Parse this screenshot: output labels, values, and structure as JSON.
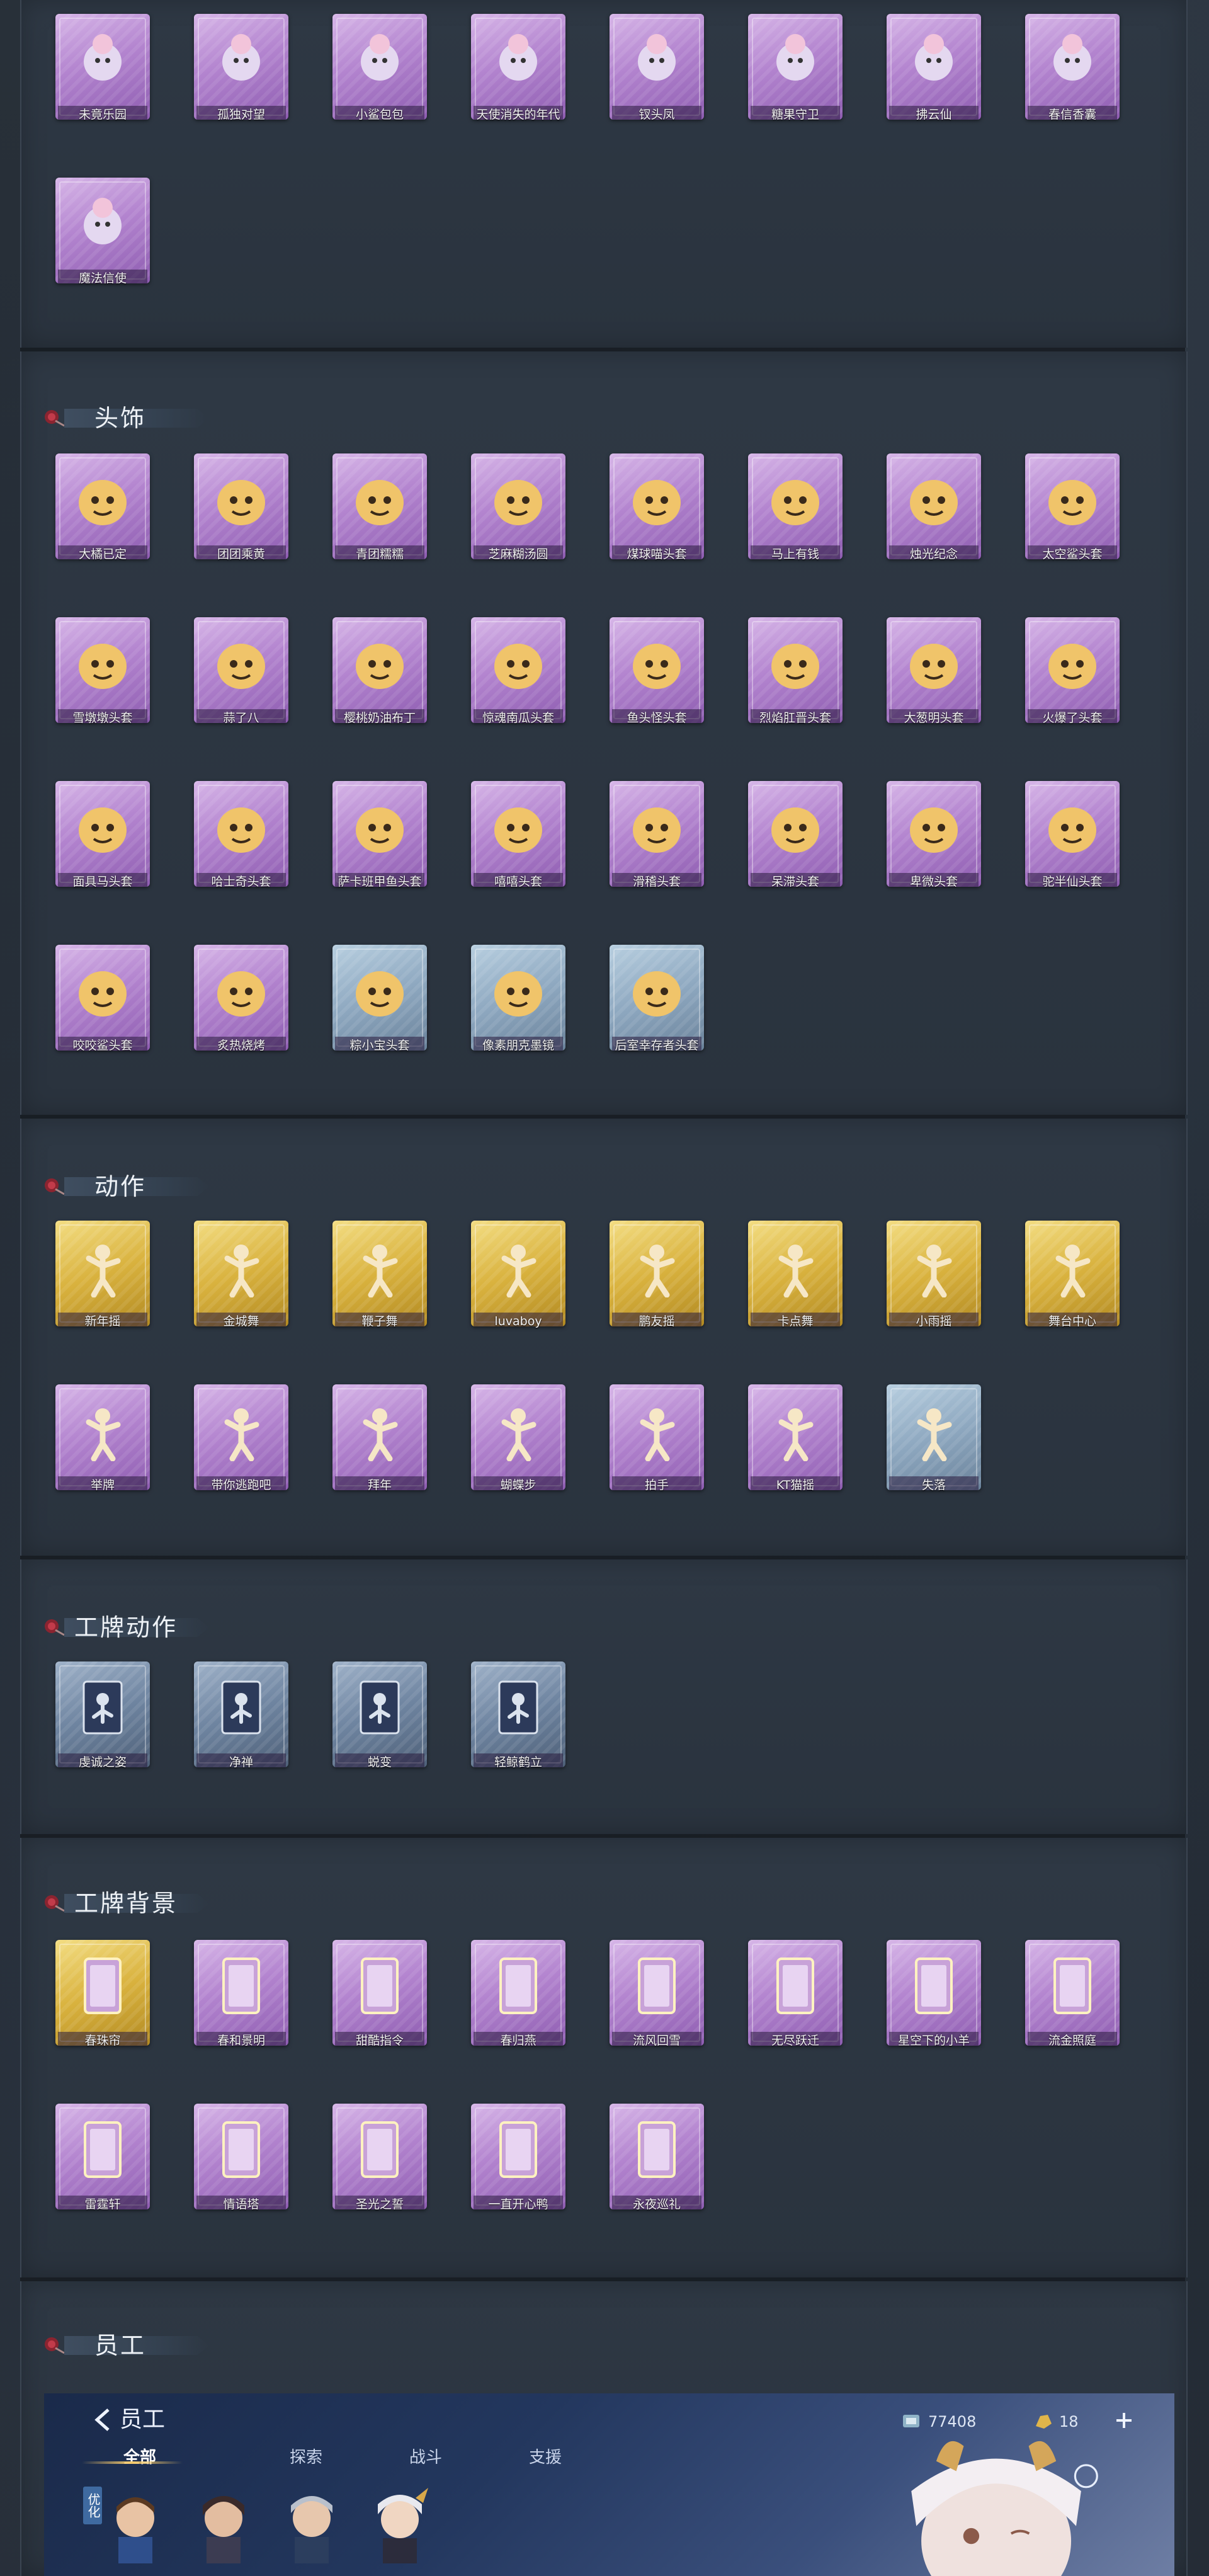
{
  "sections": {
    "top_items": [
      {
        "label": "未竟乐园",
        "icon": "pink-hair-doll",
        "rarity": "purple"
      },
      {
        "label": "孤独对望",
        "icon": "silver-lantern",
        "rarity": "purple"
      },
      {
        "label": "小鲨包包",
        "icon": "shark-plush",
        "rarity": "purple"
      },
      {
        "label": "天使消失的年代",
        "icon": "angel-portrait",
        "rarity": "purple"
      },
      {
        "label": "钗头凤",
        "icon": "phoenix-hairpin",
        "rarity": "purple"
      },
      {
        "label": "糖果守卫",
        "icon": "candy-guard",
        "rarity": "purple"
      },
      {
        "label": "拂云仙",
        "icon": "cloud-fairy",
        "rarity": "purple"
      },
      {
        "label": "春信香囊",
        "icon": "green-sachet",
        "rarity": "purple"
      },
      {
        "label": "魔法信使",
        "icon": "elephant-plush",
        "rarity": "purple"
      }
    ],
    "headwear": {
      "title": "头饰",
      "items": [
        {
          "label": "大橘已定",
          "icon": "orange-face",
          "rarity": "purple"
        },
        {
          "label": "团团乘黄",
          "icon": "hamster-face",
          "rarity": "purple"
        },
        {
          "label": "青团糯糯",
          "icon": "green-bun",
          "rarity": "purple"
        },
        {
          "label": "芝麻糊汤圆",
          "icon": "rice-ball",
          "rarity": "purple"
        },
        {
          "label": "煤球喵头套",
          "icon": "black-cat-head",
          "rarity": "purple"
        },
        {
          "label": "马上有钱",
          "icon": "red-horse-head",
          "rarity": "purple"
        },
        {
          "label": "烛光纪念",
          "icon": "candle-head",
          "rarity": "purple"
        },
        {
          "label": "太空鲨头套",
          "icon": "space-shark-head",
          "rarity": "purple"
        },
        {
          "label": "雪墩墩头套",
          "icon": "snow-bear-head",
          "rarity": "purple"
        },
        {
          "label": "蒜了八",
          "icon": "garlic-head",
          "rarity": "purple"
        },
        {
          "label": "樱桃奶油布丁",
          "icon": "pudding-head",
          "rarity": "purple"
        },
        {
          "label": "惊魂南瓜头套",
          "icon": "pumpkin-head",
          "rarity": "purple"
        },
        {
          "label": "鱼头怪头套",
          "icon": "fish-head",
          "rarity": "purple"
        },
        {
          "label": "烈焰肛晋头套",
          "icon": "yellow-rabbit-head",
          "rarity": "purple"
        },
        {
          "label": "大葱明头套",
          "icon": "scallion-head",
          "rarity": "purple"
        },
        {
          "label": "火爆了头套",
          "icon": "fire-head",
          "rarity": "purple"
        },
        {
          "label": "面具马头套",
          "icon": "horse-mask",
          "rarity": "purple"
        },
        {
          "label": "哈士奇头套",
          "icon": "husky-head",
          "rarity": "purple"
        },
        {
          "label": "萨卡班甲鱼头套",
          "icon": "fish-helmet",
          "rarity": "purple"
        },
        {
          "label": "嘻嘻头套",
          "icon": "grin-emoji",
          "rarity": "purple"
        },
        {
          "label": "滑稽头套",
          "icon": "funny-emoji",
          "rarity": "purple"
        },
        {
          "label": "呆滞头套",
          "icon": "dazed-emoji",
          "rarity": "purple"
        },
        {
          "label": "卑微头套",
          "icon": "humble-emoji",
          "rarity": "purple"
        },
        {
          "label": "驼半仙头套",
          "icon": "raccoon-head",
          "rarity": "purple"
        },
        {
          "label": "咬咬鲨头套",
          "icon": "bite-shark-head",
          "rarity": "purple"
        },
        {
          "label": "炙热烧烤",
          "icon": "bbq-head",
          "rarity": "purple"
        },
        {
          "label": "粽小宝头套",
          "icon": "zongzi-head",
          "rarity": "blue"
        },
        {
          "label": "像素朋克墨镜",
          "icon": "pixel-sunglasses",
          "rarity": "blue"
        },
        {
          "label": "后室幸存者头套",
          "icon": "survivor-helmet",
          "rarity": "blue"
        }
      ]
    },
    "actions": {
      "title": "动作",
      "items": [
        {
          "label": "新年摇",
          "icon": "dance-pose",
          "rarity": "gold"
        },
        {
          "label": "金城舞",
          "icon": "dance-pose",
          "rarity": "gold"
        },
        {
          "label": "鞭子舞",
          "icon": "dance-pose",
          "rarity": "gold"
        },
        {
          "label": "luvaboy",
          "icon": "dance-pose",
          "rarity": "gold"
        },
        {
          "label": "鹏友摇",
          "icon": "dance-pose",
          "rarity": "gold"
        },
        {
          "label": "卡点舞",
          "icon": "dance-pose",
          "rarity": "gold"
        },
        {
          "label": "小雨摇",
          "icon": "dance-pose",
          "rarity": "gold"
        },
        {
          "label": "舞台中心",
          "icon": "dance-pose",
          "rarity": "gold"
        },
        {
          "label": "举牌",
          "icon": "sign-pose",
          "rarity": "purple"
        },
        {
          "label": "带你逃跑吧",
          "icon": "run-pose",
          "rarity": "purple"
        },
        {
          "label": "拜年",
          "icon": "bow-pose",
          "rarity": "purple"
        },
        {
          "label": "蝴蝶步",
          "icon": "butterfly-pose",
          "rarity": "purple"
        },
        {
          "label": "拍手",
          "icon": "clap-pose",
          "rarity": "purple"
        },
        {
          "label": "KT猫摇",
          "icon": "cat-pose",
          "rarity": "purple"
        },
        {
          "label": "失落",
          "icon": "crawl-pose",
          "rarity": "blue"
        }
      ]
    },
    "badge_actions": {
      "title": "工牌动作",
      "items": [
        {
          "label": "虔诚之姿",
          "icon": "card-pose",
          "rarity": "navy"
        },
        {
          "label": "净禅",
          "icon": "card-pose",
          "rarity": "navy"
        },
        {
          "label": "蜕变",
          "icon": "card-pose",
          "rarity": "navy"
        },
        {
          "label": "轻鲸鹤立",
          "icon": "card-pose",
          "rarity": "navy"
        }
      ]
    },
    "badge_backgrounds": {
      "title": "工牌背景",
      "items": [
        {
          "label": "春珠帘",
          "icon": "red-card",
          "rarity": "gold"
        },
        {
          "label": "春和景明",
          "icon": "yellow-card",
          "rarity": "purple"
        },
        {
          "label": "甜酷指令",
          "icon": "pink-card",
          "rarity": "purple"
        },
        {
          "label": "春归燕",
          "icon": "rose-card",
          "rarity": "purple"
        },
        {
          "label": "流风回雪",
          "icon": "pastel-card",
          "rarity": "purple"
        },
        {
          "label": "无尽跃迁",
          "icon": "galaxy-card",
          "rarity": "purple"
        },
        {
          "label": "星空下的小羊",
          "icon": "sky-card",
          "rarity": "purple"
        },
        {
          "label": "流金照庭",
          "icon": "gold-frame-card",
          "rarity": "purple"
        },
        {
          "label": "雷霆轩",
          "icon": "night-card",
          "rarity": "purple"
        },
        {
          "label": "情语塔",
          "icon": "tower-card",
          "rarity": "purple"
        },
        {
          "label": "圣光之誓",
          "icon": "holy-card",
          "rarity": "purple"
        },
        {
          "label": "一直开心鸭",
          "icon": "duck-card",
          "rarity": "purple"
        },
        {
          "label": "永夜巡礼",
          "icon": "dark-card",
          "rarity": "purple"
        }
      ]
    },
    "staff": {
      "title": "员工",
      "ui_title": "员工",
      "tabs": [
        "全部",
        "探索",
        "战斗",
        "支援"
      ],
      "active_tab": "全部",
      "currency_1": "77408",
      "currency_2": "18",
      "vertical_tag": "优化"
    }
  },
  "colors": {
    "purple": "#b384cf",
    "gold": "#d9b23e",
    "blue": "#8ea8c0",
    "navy": "#6e84a0",
    "header_flag": "#3f4e60",
    "panel": "#2e3844"
  }
}
